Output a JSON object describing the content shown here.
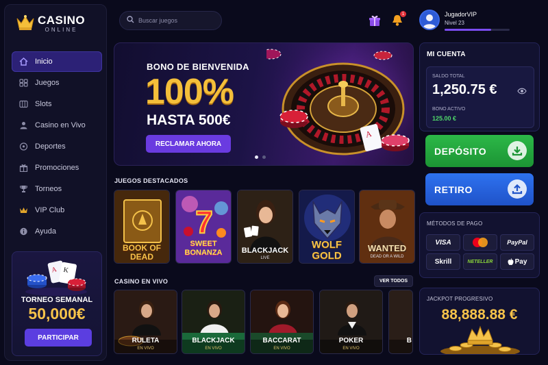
{
  "brand": {
    "name": "CASINO",
    "sub": "ONLINE"
  },
  "nav": [
    {
      "label": "Inicio",
      "icon": "home-icon"
    },
    {
      "label": "Juegos",
      "icon": "games-icon"
    },
    {
      "label": "Slots",
      "icon": "slots-icon"
    },
    {
      "label": "Casino en Vivo",
      "icon": "live-dealer-icon"
    },
    {
      "label": "Deportes",
      "icon": "soccer-ball-icon"
    },
    {
      "label": "Promociones",
      "icon": "gift-icon"
    },
    {
      "label": "Torneos",
      "icon": "trophy-icon"
    },
    {
      "label": "VIP Club",
      "icon": "crown-icon"
    },
    {
      "label": "Ayuda",
      "icon": "info-icon"
    }
  ],
  "active_nav": "Inicio",
  "tournament": {
    "title": "TORNEO SEMANAL",
    "amount": "50,000€",
    "button": "PARTICIPAR"
  },
  "search": {
    "placeholder": "Buscar juegos"
  },
  "notifications": {
    "count": "1"
  },
  "user": {
    "name": "JugadorVIP",
    "level": "Nivel 23",
    "xp_progress": 0.72
  },
  "hero": {
    "kicker": "BONO DE BIENVENIDA",
    "big": "100%",
    "line": "HASTA 500€",
    "button": "RECLAMAR AHORA",
    "slides": 2,
    "active_slide": 1
  },
  "featured": {
    "title": "JUEGOS DESTACADOS",
    "games": [
      {
        "title": "BOOK OF DEAD",
        "sub": ""
      },
      {
        "title": "SWEET BONANZA",
        "sub": ""
      },
      {
        "title": "BLACKJACK",
        "sub": "LIVE"
      },
      {
        "title": "WOLF GOLD",
        "sub": ""
      },
      {
        "title": "WANTED",
        "sub": "DEAD OR A WILD"
      }
    ]
  },
  "live": {
    "title": "CASINO EN VIVO",
    "view_all": "VER TODOS",
    "tables": [
      {
        "name": "RULETA",
        "sub": "EN VIVO"
      },
      {
        "name": "BLACKJACK",
        "sub": "EN VIVO"
      },
      {
        "name": "BACCARAT",
        "sub": "EN VIVO"
      },
      {
        "name": "POKER",
        "sub": "EN VIVO"
      },
      {
        "name": "B",
        "sub": ""
      }
    ]
  },
  "account": {
    "title": "MI CUENTA",
    "balance_label": "SALDO TOTAL",
    "balance": "1,250.75 €",
    "bonus_label": "BONO ACTIVO",
    "bonus": "125.00 €",
    "deposit": "DEPÓSITO",
    "withdraw": "RETIRO"
  },
  "payments": {
    "title": "MÉTODOS DE PAGO",
    "methods": [
      "VISA",
      "mastercard",
      "PayPal",
      "Skrill",
      "NETELLER",
      "Pay"
    ]
  },
  "jackpot": {
    "title": "JACKPOT PROGRESIVO",
    "value": "88,888.88 €"
  },
  "colors": {
    "bg": "#0a0a1c",
    "accent": "#6a3be0",
    "gold": "#f4bf3a",
    "deposit": "#22a83a",
    "withdraw": "#2563e0"
  }
}
